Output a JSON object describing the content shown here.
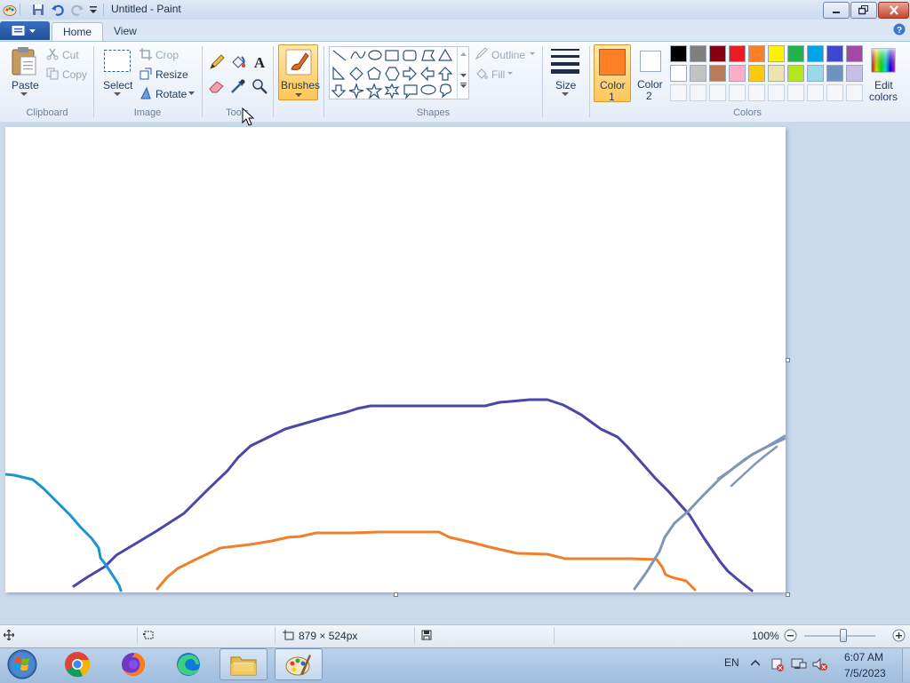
{
  "window": {
    "title": "Untitled - Paint",
    "controls": {
      "minimize": "minimize-icon",
      "maximize": "restore-icon",
      "close": "close-icon"
    }
  },
  "tabs": [
    {
      "label": "Home",
      "active": true
    },
    {
      "label": "View",
      "active": false
    }
  ],
  "ribbon": {
    "clipboard": {
      "paste": "Paste",
      "cut": "Cut",
      "copy": "Copy",
      "group": "Clipboard"
    },
    "image": {
      "select": "Select",
      "crop": "Crop",
      "resize": "Resize",
      "rotate": "Rotate",
      "group": "Image"
    },
    "tools": {
      "group": "Tools"
    },
    "brushes": {
      "label": "Brushes"
    },
    "shapes": {
      "outline": "Outline",
      "fill": "Fill",
      "group": "Shapes"
    },
    "size": {
      "label": "Size"
    },
    "color1": {
      "label": "Color",
      "num": "1",
      "value": "#ff7f27"
    },
    "color2": {
      "label": "Color",
      "num": "2",
      "value": "#ffffff"
    },
    "colors_group": "Colors",
    "edit_colors": {
      "line1": "Edit",
      "line2": "colors"
    },
    "palette_row1": [
      "#000000",
      "#7f7f7f",
      "#880015",
      "#ed1c24",
      "#ff7f27",
      "#fff200",
      "#22b14c",
      "#00a2e8",
      "#3f48cc",
      "#a349a4"
    ],
    "palette_row2": [
      "#ffffff",
      "#c3c3c3",
      "#b97a57",
      "#ffaec9",
      "#ffc90e",
      "#efe4b0",
      "#b5e61d",
      "#99d9ea",
      "#7092be",
      "#c8bfe7"
    ]
  },
  "statusbar": {
    "dimensions": "879 × 524px",
    "zoom": "100%"
  },
  "taskbar": {
    "apps": [
      "chrome-icon",
      "firefox-icon",
      "edge-icon",
      "file-explorer-icon",
      "paint-icon"
    ],
    "lang": "EN",
    "time": "6:07 AM",
    "date": "7/5/2023"
  }
}
